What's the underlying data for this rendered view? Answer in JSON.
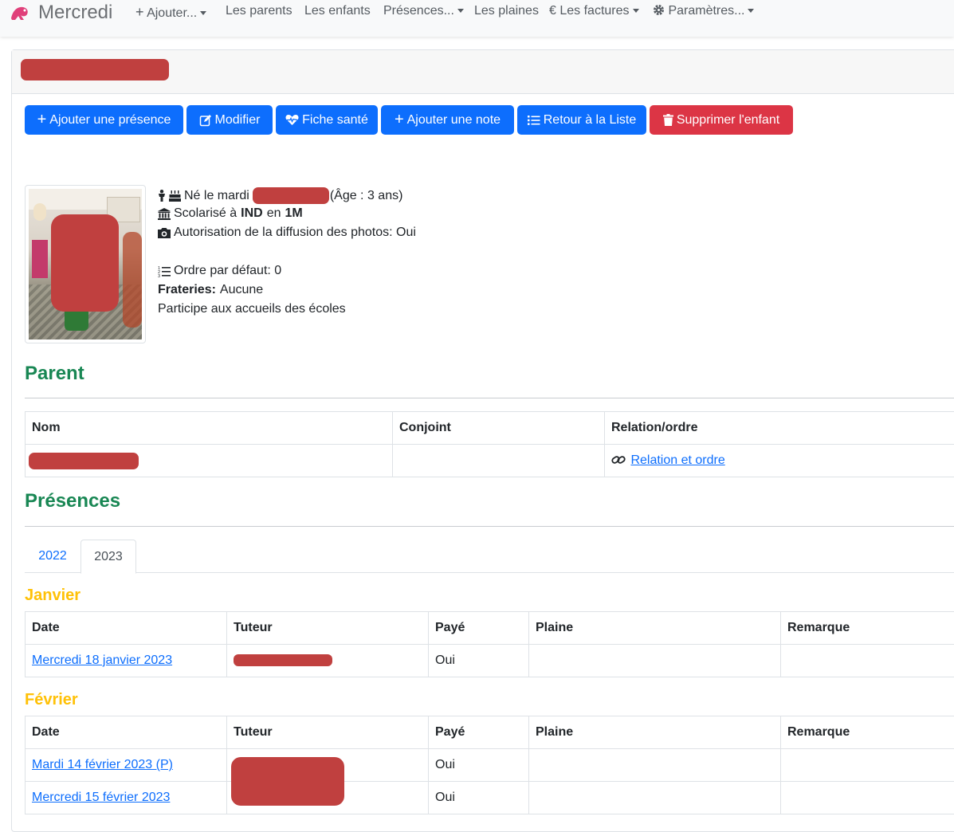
{
  "navbar": {
    "brand": "Mercredi",
    "items": {
      "ajouter": "Ajouter...",
      "parents": "Les parents",
      "enfants": "Les enfants",
      "presences": "Présences...",
      "plaines": "Les plaines",
      "factures": "Les factures",
      "parametres": "Paramètres..."
    }
  },
  "colors": {
    "primary": "#0d6efd",
    "danger": "#dc3545",
    "success": "#198754",
    "warning": "#ffc107",
    "redaction": "#c0403f"
  },
  "actions": {
    "add_presence": "Ajouter une présence",
    "edit": "Modifier",
    "health": "Fiche santé",
    "add_note": "Ajouter une note",
    "back": "Retour à la Liste",
    "delete": "Supprimer l'enfant"
  },
  "child": {
    "born_prefix": "Né le mardi",
    "age": "(Âge : 3 ans)",
    "school_prefix": "Scolarisé à",
    "school": "IND",
    "school_mid": "en",
    "grade": "1M",
    "photo_auth": "Autorisation de la diffusion des photos: Oui",
    "order": "Ordre par défaut: 0",
    "siblings_label": "Frateries:",
    "siblings_value": "Aucune",
    "accueils": "Participe aux accueils des écoles"
  },
  "parent_section": {
    "title": "Parent",
    "headers": {
      "name": "Nom",
      "spouse": "Conjoint",
      "relation": "Relation/ordre"
    },
    "row": {
      "relation_link": "Relation et ordre"
    }
  },
  "presences_section": {
    "title": "Présences",
    "tabs": {
      "y2022": "2022",
      "y2023": "2023"
    },
    "headers": {
      "date": "Date",
      "tutor": "Tuteur",
      "paid": "Payé",
      "plaine": "Plaine",
      "remark": "Remarque"
    },
    "months": [
      {
        "name": "Janvier",
        "rows": [
          {
            "date": "Mercredi 18 janvier 2023",
            "paid": "Oui"
          }
        ]
      },
      {
        "name": "Février",
        "rows": [
          {
            "date": "Mardi 14 février 2023 (P)",
            "paid": "Oui"
          },
          {
            "date": "Mercredi 15 février 2023",
            "paid": "Oui"
          }
        ]
      }
    ]
  }
}
